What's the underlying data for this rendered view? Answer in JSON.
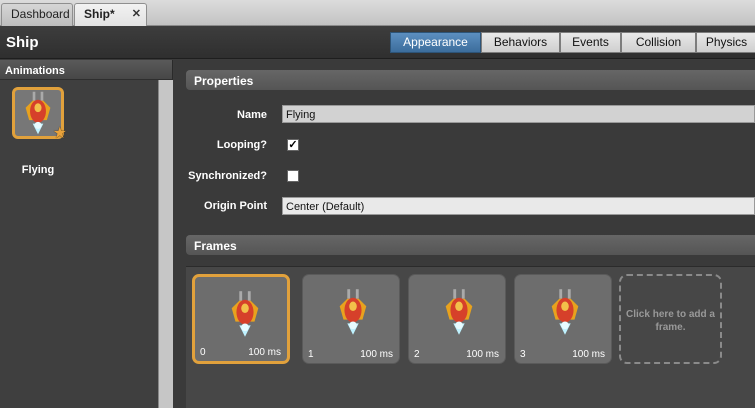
{
  "tabs": [
    {
      "label": "Dashboard"
    },
    {
      "label": "Ship*",
      "close": "✕"
    }
  ],
  "header": {
    "title": "Ship",
    "tabs": [
      {
        "label": "Appearance"
      },
      {
        "label": "Behaviors"
      },
      {
        "label": "Events"
      },
      {
        "label": "Collision"
      },
      {
        "label": "Physics"
      }
    ]
  },
  "animations": {
    "header": "Animations",
    "items": [
      {
        "label": "Flying"
      }
    ]
  },
  "properties": {
    "header": "Properties",
    "name_label": "Name",
    "name_value": "Flying",
    "looping_label": "Looping?",
    "looping_checked": true,
    "sync_label": "Synchronized?",
    "sync_checked": false,
    "origin_label": "Origin Point",
    "origin_value": "Center (Default)"
  },
  "frames": {
    "header": "Frames",
    "items": [
      {
        "index": "0",
        "duration": "100 ms"
      },
      {
        "index": "1",
        "duration": "100 ms"
      },
      {
        "index": "2",
        "duration": "100 ms"
      },
      {
        "index": "3",
        "duration": "100 ms"
      }
    ],
    "add_label": "Click here to add a frame."
  },
  "colors": {
    "accent": "#e1a13c",
    "active_tab": "#4a7fb0"
  }
}
